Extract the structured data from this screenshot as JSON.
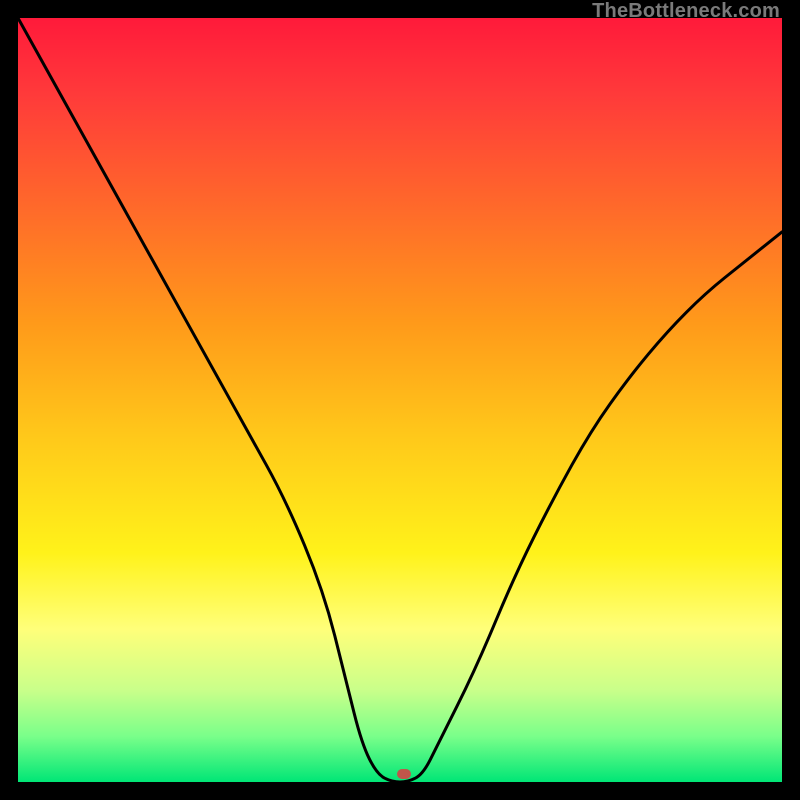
{
  "watermark": "TheBottleneck.com",
  "colors": {
    "frame": "#000000",
    "dot": "#c0564a",
    "curve": "#000000"
  },
  "chart_data": {
    "type": "line",
    "title": "",
    "xlabel": "",
    "ylabel": "",
    "xlim": [
      0,
      100
    ],
    "ylim": [
      0,
      100
    ],
    "x": [
      0,
      5,
      10,
      15,
      20,
      25,
      30,
      35,
      40,
      43,
      45,
      47,
      49,
      51,
      53,
      55,
      60,
      65,
      70,
      75,
      80,
      85,
      90,
      95,
      100
    ],
    "values": [
      100,
      91,
      82,
      73,
      64,
      55,
      46,
      37,
      25,
      13,
      5,
      1,
      0,
      0,
      1,
      5,
      15,
      27,
      37,
      46,
      53,
      59,
      64,
      68,
      72
    ],
    "optimum_x": 50,
    "optimum_y": 0,
    "annotations": []
  },
  "dot": {
    "x_pct": 50.5,
    "y_pct": 99.3
  }
}
